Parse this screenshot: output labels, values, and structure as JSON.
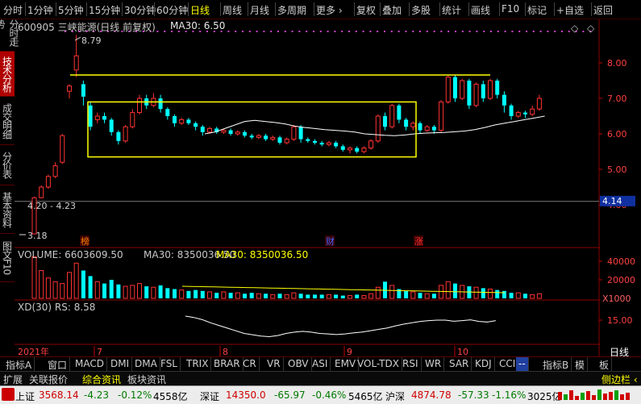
{
  "topbar": {
    "items": [
      "分时",
      "1分钟",
      "5分钟",
      "15分钟",
      "30分钟",
      "60分钟",
      "日线",
      "周线",
      "月线",
      "多周期",
      "更多 ›",
      "复权",
      "叠加",
      "多股",
      "统计",
      "画线",
      "F10",
      "标记",
      "+自选",
      "返回"
    ],
    "active": "日线"
  },
  "leftbar": {
    "tabs": [
      "分时走势",
      "技术分析",
      "成交明细",
      "分价表",
      "基本资料",
      "图文F10"
    ],
    "active": "技术分析"
  },
  "header": {
    "stock": "600905 三峡能源(日线 前复权)",
    "ma_label": "MA30: 6.50"
  },
  "annotations": {
    "high": "8.79",
    "range": "4.20 - 4.23",
    "low": "3.18",
    "markers": [
      "榜",
      "财",
      "涨"
    ]
  },
  "price_axis": {
    "ticks": [
      "8.00",
      "7.00",
      "6.00",
      "5.00",
      "4.00"
    ],
    "current": "4.14"
  },
  "volume": {
    "volume_label": "VOLUME: 6603609.50",
    "ma30_label": "MA30: 8350036.50",
    "ma30_label_2": "MA30: 8350036.50",
    "ticks": [
      "40000",
      "20000"
    ],
    "unit": "X1000"
  },
  "rs": {
    "label": "XD(30)  RS: 8.58",
    "ticks": [
      "15.00"
    ]
  },
  "time_axis": {
    "labels": [
      "2021年",
      "7",
      "8",
      "9",
      "10"
    ],
    "right_label": "日线"
  },
  "indicator_tabs": {
    "items": [
      "指标A",
      "窗口",
      "MACD",
      "DMI",
      "DMA",
      "FSL",
      "TRIX",
      "BRAR",
      "CR",
      "VR",
      "OBV",
      "ASI",
      "EMV",
      "VOL-TDX",
      "RSI",
      "WR",
      "SAR",
      "KDJ",
      "CCI",
      "--",
      "指标B",
      "模",
      "板"
    ]
  },
  "sub_tabs": {
    "items": [
      "扩展",
      "关联报价",
      "综合资讯",
      "板块资讯"
    ],
    "active": "综合资讯",
    "right": "侧边栏 ‹"
  },
  "status_bar": {
    "sh": {
      "name": "上证",
      "value": "3568.14",
      "chg": "-4.23",
      "pct": "-0.12%",
      "amt": "4558亿"
    },
    "sz": {
      "name": "深证",
      "value": "14350.0",
      "chg": "-65.97",
      "pct": "-0.46%",
      "amt": "5465亿"
    },
    "hs": {
      "name": "沪深",
      "value": "4874.78",
      "chg": "-57.33",
      "pct": "-1.16%",
      "amt": "3025亿"
    }
  },
  "colors": {
    "up": "#ff3232",
    "down": "#00ffff",
    "ma": "#ffffff",
    "box": "#ffff00",
    "grid_red": "#8b0000"
  },
  "chart_data": {
    "type": "candlestick",
    "series": [
      {
        "name": "K",
        "ohlc": [
          [
            3.18,
            4.2,
            3.18,
            4.23
          ],
          [
            4.2,
            4.5,
            4.18,
            4.55
          ],
          [
            4.5,
            4.8,
            4.45,
            4.85
          ],
          [
            4.8,
            5.1,
            4.75,
            5.2
          ],
          [
            5.2,
            5.95,
            5.15,
            6.0
          ],
          [
            7.2,
            7.35,
            7.0,
            7.4
          ],
          [
            7.8,
            8.2,
            7.6,
            8.79
          ],
          [
            7.4,
            7.05,
            6.8,
            7.5
          ],
          [
            6.8,
            6.2,
            6.1,
            6.9
          ],
          [
            6.4,
            6.5,
            6.3,
            6.6
          ],
          [
            6.5,
            6.4,
            6.3,
            6.6
          ],
          [
            6.4,
            6.05,
            5.95,
            6.45
          ],
          [
            6.05,
            5.8,
            5.7,
            6.1
          ],
          [
            5.8,
            6.2,
            5.75,
            6.25
          ],
          [
            6.2,
            6.6,
            6.15,
            6.7
          ],
          [
            6.6,
            7.0,
            6.55,
            7.1
          ],
          [
            7.0,
            6.8,
            6.7,
            7.1
          ],
          [
            6.8,
            7.0,
            6.75,
            7.15
          ],
          [
            7.0,
            6.7,
            6.6,
            7.1
          ],
          [
            6.7,
            6.5,
            6.4,
            6.75
          ],
          [
            6.5,
            6.3,
            6.2,
            6.55
          ],
          [
            6.3,
            6.4,
            6.25,
            6.45
          ],
          [
            6.4,
            6.3,
            6.25,
            6.45
          ],
          [
            6.3,
            6.2,
            6.1,
            6.35
          ],
          [
            6.2,
            6.05,
            5.95,
            6.25
          ],
          [
            6.05,
            6.15,
            6.0,
            6.2
          ],
          [
            6.15,
            6.05,
            6.0,
            6.2
          ],
          [
            6.05,
            6.1,
            6.0,
            6.15
          ],
          [
            6.1,
            6.0,
            5.95,
            6.15
          ],
          [
            6.0,
            6.05,
            5.95,
            6.1
          ],
          [
            6.05,
            5.95,
            5.9,
            6.1
          ],
          [
            5.95,
            5.9,
            5.85,
            6.0
          ],
          [
            5.9,
            5.95,
            5.85,
            6.0
          ],
          [
            5.95,
            5.85,
            5.8,
            6.0
          ],
          [
            5.85,
            5.9,
            5.8,
            5.95
          ],
          [
            5.9,
            5.75,
            5.7,
            5.95
          ],
          [
            5.75,
            5.85,
            5.7,
            5.9
          ],
          [
            5.85,
            6.2,
            5.8,
            6.25
          ],
          [
            6.2,
            5.85,
            5.75,
            6.25
          ],
          [
            5.85,
            5.8,
            5.75,
            5.9
          ],
          [
            5.8,
            5.75,
            5.7,
            5.85
          ],
          [
            5.75,
            5.7,
            5.65,
            5.8
          ],
          [
            5.7,
            5.75,
            5.65,
            5.8
          ],
          [
            5.75,
            5.65,
            5.6,
            5.8
          ],
          [
            5.65,
            5.55,
            5.5,
            5.7
          ],
          [
            5.55,
            5.6,
            5.45,
            5.65
          ],
          [
            5.6,
            5.5,
            5.45,
            5.65
          ],
          [
            5.5,
            5.6,
            5.45,
            5.65
          ],
          [
            5.6,
            5.8,
            5.55,
            5.85
          ],
          [
            5.8,
            6.5,
            5.75,
            6.55
          ],
          [
            6.5,
            6.2,
            6.1,
            6.6
          ],
          [
            6.2,
            6.8,
            6.15,
            6.85
          ],
          [
            6.8,
            6.4,
            6.3,
            6.85
          ],
          [
            6.4,
            6.2,
            6.1,
            6.45
          ],
          [
            6.2,
            6.3,
            6.1,
            6.35
          ],
          [
            6.3,
            6.1,
            6.0,
            6.35
          ],
          [
            6.1,
            6.2,
            6.05,
            6.25
          ],
          [
            6.2,
            6.1,
            6.0,
            6.25
          ],
          [
            6.1,
            6.9,
            6.05,
            6.95
          ],
          [
            6.9,
            7.6,
            6.85,
            7.65
          ],
          [
            7.6,
            7.0,
            6.9,
            7.65
          ],
          [
            7.0,
            7.5,
            6.95,
            7.55
          ],
          [
            7.5,
            6.8,
            6.7,
            7.55
          ],
          [
            6.8,
            7.4,
            6.75,
            7.45
          ],
          [
            7.4,
            7.0,
            6.9,
            7.5
          ],
          [
            7.0,
            7.5,
            6.95,
            7.55
          ],
          [
            7.5,
            7.1,
            7.0,
            7.55
          ],
          [
            7.1,
            6.8,
            6.6,
            7.2
          ],
          [
            6.8,
            6.5,
            6.4,
            6.85
          ],
          [
            6.5,
            6.6,
            6.45,
            6.65
          ],
          [
            6.6,
            6.55,
            6.45,
            6.65
          ],
          [
            6.55,
            6.7,
            6.5,
            6.8
          ],
          [
            6.7,
            7.0,
            6.65,
            7.1
          ]
        ]
      },
      {
        "name": "MA30",
        "values": [
          6.0,
          6.05,
          6.15,
          6.25,
          6.35,
          6.38,
          6.35,
          6.32,
          6.28,
          6.22,
          6.18,
          6.15,
          6.12,
          6.1,
          6.08,
          6.05,
          6.0,
          5.98,
          5.96,
          5.95,
          5.97,
          6.0,
          6.02,
          6.03,
          6.04,
          6.06,
          6.08,
          6.12,
          6.18,
          6.25,
          6.3,
          6.35,
          6.4,
          6.45,
          6.5
        ]
      },
      {
        "name": "VOLUME",
        "values": [
          45000,
          30000,
          22000,
          18000,
          16000,
          28000,
          38000,
          30000,
          24000,
          18000,
          16000,
          20000,
          15000,
          13000,
          14000,
          16000,
          13000,
          12000,
          14000,
          11000,
          10000,
          9000,
          8000,
          9000,
          8000,
          7000,
          6000,
          7000,
          6000,
          6000,
          5000,
          6000,
          5000,
          5000,
          4000,
          5000,
          4000,
          6000,
          5000,
          4000,
          4000,
          4000,
          4000,
          4000,
          3000,
          3000,
          4000,
          3000,
          5000,
          12000,
          18000,
          14000,
          10000,
          8000,
          7000,
          6000,
          5000,
          5000,
          14000,
          18000,
          16000,
          14000,
          13000,
          12000,
          11000,
          10000,
          9000,
          8000,
          6000,
          6000,
          5000,
          4000,
          5000
        ]
      },
      {
        "name": "RS",
        "values": [
          16.5,
          16.0,
          15.2,
          14.0,
          13.0,
          12.0,
          11.0,
          10.0,
          9.5,
          9.0,
          8.8,
          9.2,
          10.0,
          10.5,
          10.8,
          10.5,
          10.0,
          9.8,
          9.6,
          9.8,
          10.2,
          10.5,
          11.0,
          11.5,
          12.0,
          12.8,
          13.5,
          14.0,
          14.5,
          14.8,
          15.0,
          15.0,
          14.6,
          14.8,
          15.1,
          14.5,
          14.3,
          14.8
        ]
      }
    ],
    "ylim": [
      3.0,
      9.0
    ],
    "box_lines": [
      7.66,
      6.9,
      5.35
    ],
    "xlabels": [
      "7",
      "8",
      "9",
      "10"
    ]
  }
}
